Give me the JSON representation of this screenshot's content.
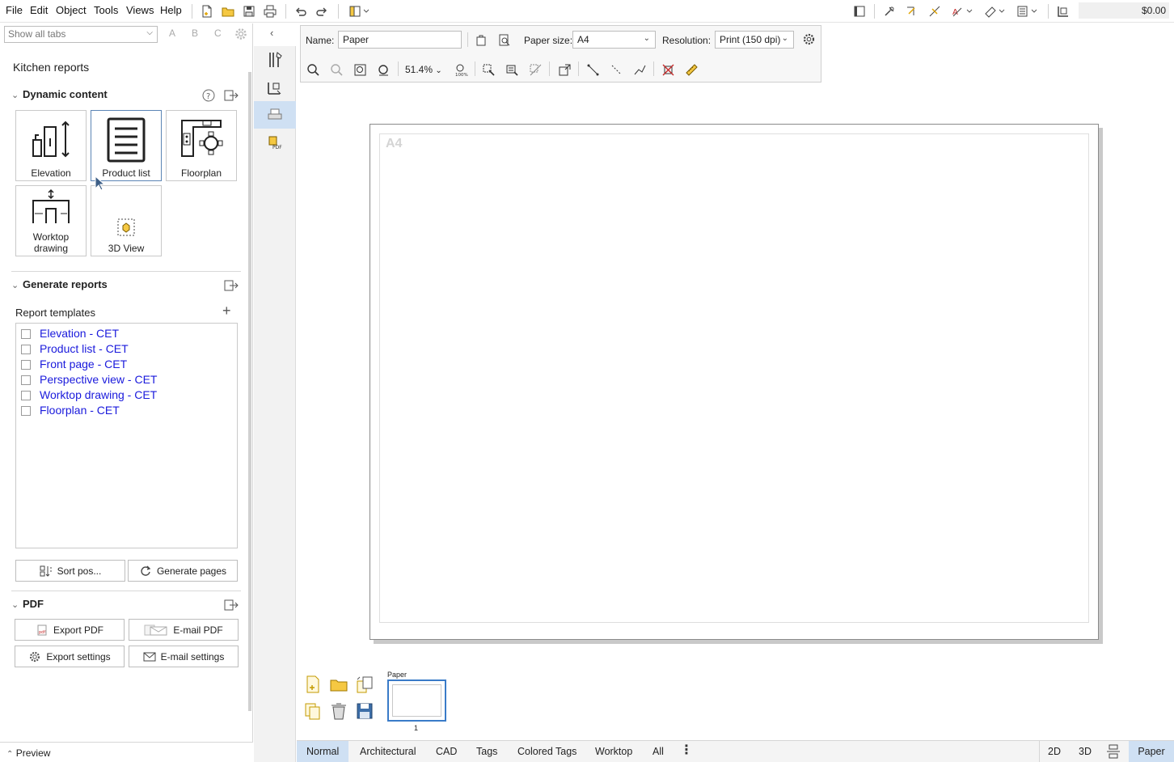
{
  "menubar": {
    "items": [
      "File",
      "Edit",
      "Object",
      "Tools",
      "Views",
      "Help"
    ],
    "price": "$0.00"
  },
  "left_panel": {
    "tab_filter": "Show all tabs",
    "abc": [
      "A",
      "B",
      "C"
    ],
    "title": "Kitchen reports",
    "dynamic_content": {
      "header": "Dynamic content",
      "tiles": [
        {
          "label": "Elevation",
          "icon": "elevation-icon"
        },
        {
          "label": "Product list",
          "icon": "product-list-icon"
        },
        {
          "label": "Floorplan",
          "icon": "floorplan-icon"
        },
        {
          "label": "Worktop\ndrawing",
          "icon": "worktop-drawing-icon"
        },
        {
          "label": "3D View",
          "icon": "3d-view-icon"
        }
      ]
    },
    "generate_reports": {
      "header": "Generate reports",
      "templates_label": "Report templates",
      "templates": [
        "Elevation - CET",
        "Product list - CET",
        "Front page - CET",
        "Perspective view - CET",
        "Worktop drawing - CET",
        "Floorplan - CET"
      ],
      "sort_button": "Sort pos...",
      "generate_button": "Generate pages"
    },
    "pdf": {
      "header": "PDF",
      "export_pdf": "Export PDF",
      "email_pdf": "E-mail PDF",
      "export_settings": "Export settings",
      "email_settings": "E-mail settings"
    },
    "preview": "Preview"
  },
  "paper_toolbar": {
    "name_label": "Name:",
    "name_value": "Paper",
    "paper_size_label": "Paper size:",
    "paper_size_value": "A4",
    "resolution_label": "Resolution:",
    "resolution_value": "Print (150 dpi)",
    "zoom": "51.4%"
  },
  "canvas": {
    "paper_size_watermark": "A4"
  },
  "page_manager": {
    "page_label": "Paper",
    "page_number": "1"
  },
  "bottom_bar": {
    "layers": [
      "Normal",
      "Architectural",
      "CAD",
      "Tags",
      "Colored Tags",
      "Worktop",
      "All"
    ],
    "active_layer": "Normal",
    "views": [
      "2D",
      "3D",
      "Paper"
    ],
    "active_view": "Paper"
  },
  "colors": {
    "accent": "#cfe0f3",
    "link": "#1a1adc",
    "selection_border": "#3a7bc8"
  }
}
